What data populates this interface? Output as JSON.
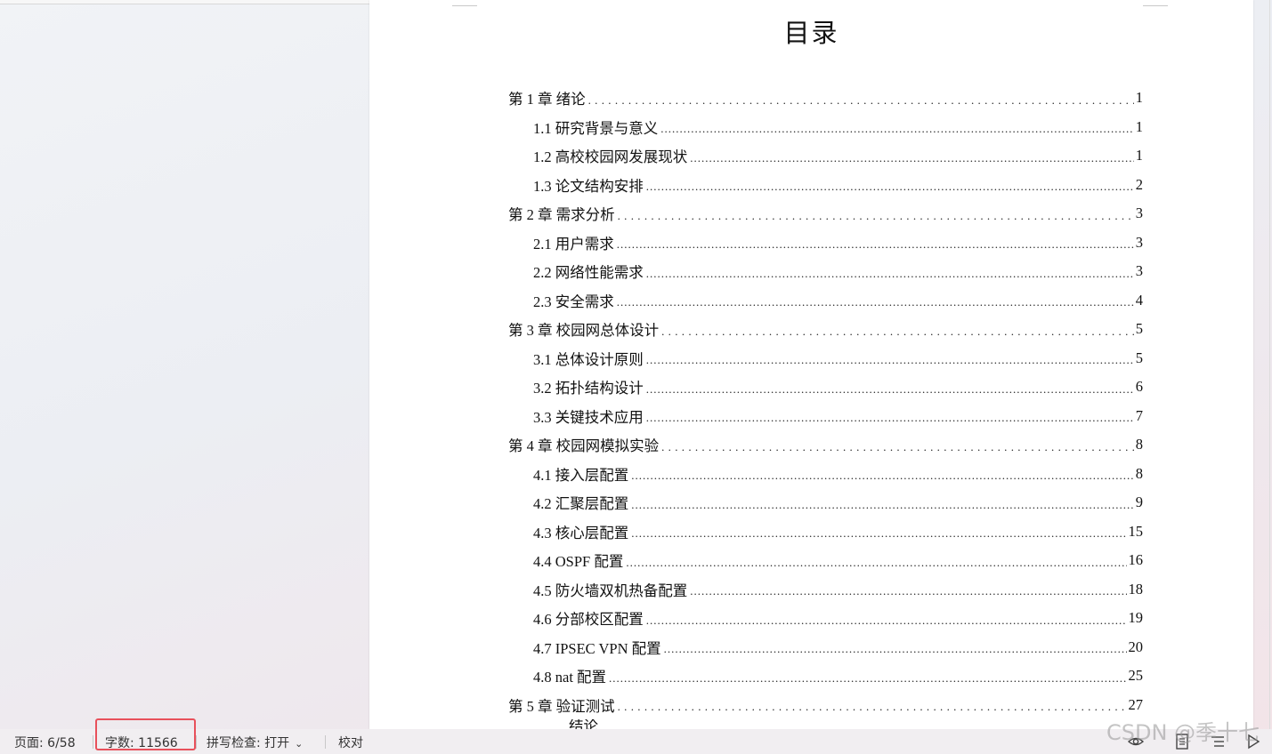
{
  "document": {
    "title": "目录",
    "toc": [
      {
        "level": 1,
        "label": "第 1 章  绪论",
        "page": "1"
      },
      {
        "level": 2,
        "label": "1.1  研究背景与意义",
        "page": "1"
      },
      {
        "level": 2,
        "label": "1.2  高校校园网发展现状",
        "page": "1"
      },
      {
        "level": 2,
        "label": "1.3  论文结构安排",
        "page": "2"
      },
      {
        "level": 1,
        "label": "第 2 章  需求分析",
        "page": "3"
      },
      {
        "level": 2,
        "label": "2.1  用户需求",
        "page": "3"
      },
      {
        "level": 2,
        "label": "2.2  网络性能需求",
        "page": "3"
      },
      {
        "level": 2,
        "label": "2.3  安全需求",
        "page": "4"
      },
      {
        "level": 1,
        "label": "第 3 章  校园网总体设计",
        "page": "5"
      },
      {
        "level": 2,
        "label": "3.1  总体设计原则",
        "page": "5"
      },
      {
        "level": 2,
        "label": "3.2  拓扑结构设计",
        "page": "6"
      },
      {
        "level": 2,
        "label": "3.3  关键技术应用",
        "page": "7"
      },
      {
        "level": 1,
        "label": "第 4 章  校园网模拟实验",
        "page": "8"
      },
      {
        "level": 2,
        "label": "4.1  接入层配置",
        "page": "8"
      },
      {
        "level": 2,
        "label": "4.2  汇聚层配置",
        "page": "9"
      },
      {
        "level": 2,
        "label": "4.3  核心层配置",
        "page": "15"
      },
      {
        "level": 2,
        "label": "4.4 OSPF 配置",
        "page": "16"
      },
      {
        "level": 2,
        "label": "4.5  防火墙双机热备配置",
        "page": "18"
      },
      {
        "level": 2,
        "label": "4.6  分部校区配置",
        "page": "19"
      },
      {
        "level": 2,
        "label": "4.7 IPSEC VPN 配置",
        "page": "20"
      },
      {
        "level": 2,
        "label": "4.8 nat 配置",
        "page": "25"
      },
      {
        "level": 1,
        "label": "第 5 章  验证测试",
        "page": "27"
      }
    ],
    "partial_entry": "结论"
  },
  "statusbar": {
    "page": "页面: 6/58",
    "word_count": "字数: 11566",
    "spell_check": "拼写检查: 打开",
    "proofread": "校对"
  },
  "watermark": "CSDN @季十七",
  "icons": [
    "eye-icon",
    "page-view-icon",
    "outline-view-icon",
    "play-icon",
    "chevron-down-icon"
  ],
  "colors": {
    "highlight": "#e8505b",
    "page_bg": "#ffffff",
    "statusbar_bg": "#f1eef1"
  }
}
